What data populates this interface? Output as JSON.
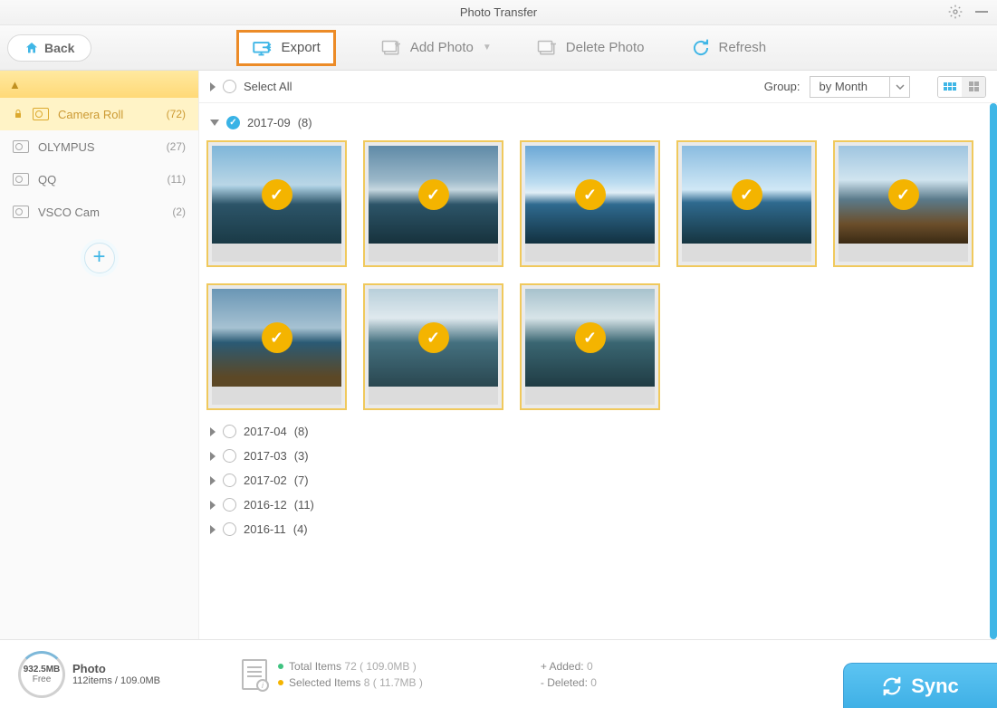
{
  "title": "Photo Transfer",
  "back_label": "Back",
  "toolbar": {
    "export": "Export",
    "add_photo": "Add Photo",
    "delete_photo": "Delete Photo",
    "refresh": "Refresh"
  },
  "sidebar": {
    "items": [
      {
        "name": "Camera Roll",
        "count": "(72)",
        "locked": true
      },
      {
        "name": "OLYMPUS",
        "count": "(27)",
        "locked": false
      },
      {
        "name": "QQ",
        "count": "(11)",
        "locked": false
      },
      {
        "name": "VSCO Cam",
        "count": "(2)",
        "locked": false
      }
    ]
  },
  "filter": {
    "select_all": "Select All",
    "group_label": "Group:",
    "group_value": "by Month"
  },
  "groups": [
    {
      "label": "2017-09",
      "count": "(8)",
      "expanded": true,
      "checked": true,
      "thumbs": 8
    },
    {
      "label": "2017-04",
      "count": "(8)",
      "expanded": false,
      "checked": false
    },
    {
      "label": "2017-03",
      "count": "(3)",
      "expanded": false,
      "checked": false
    },
    {
      "label": "2017-02",
      "count": "(7)",
      "expanded": false,
      "checked": false
    },
    {
      "label": "2016-12",
      "count": "(11)",
      "expanded": false,
      "checked": false
    },
    {
      "label": "2016-11",
      "count": "(4)",
      "expanded": false,
      "checked": false
    }
  ],
  "status": {
    "storage_size": "932.5MB",
    "storage_free": "Free",
    "section_label": "Photo",
    "section_detail": "112items / 109.0MB",
    "total_label": "Total Items",
    "total_value": "72 ( 109.0MB )",
    "selected_label": "Selected Items",
    "selected_value": "8 ( 11.7MB )",
    "added_label": "+ Added:",
    "added_value": "0",
    "deleted_label": "- Deleted:",
    "deleted_value": "0",
    "sync": "Sync"
  }
}
